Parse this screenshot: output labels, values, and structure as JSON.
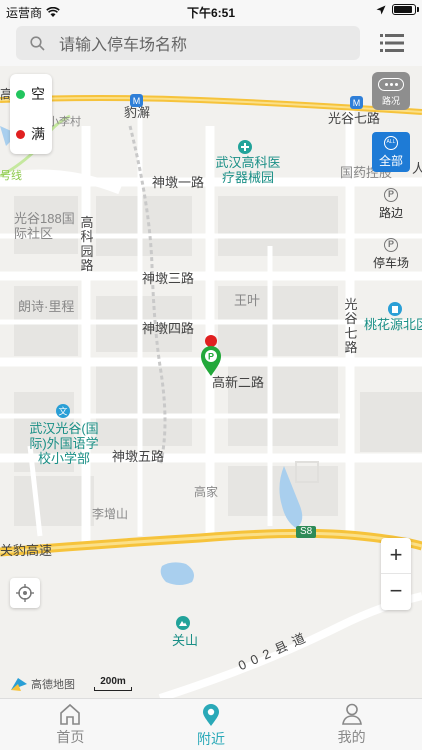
{
  "status_bar": {
    "carrier": "运营商",
    "time": "下午6:51",
    "battery_level": 0.9
  },
  "search": {
    "placeholder": "请输入停车场名称",
    "icon": "search-icon"
  },
  "header": {
    "menu_icon": "list-menu-icon"
  },
  "legend": {
    "empty_label": "空",
    "full_label": "满",
    "empty_color": "#22c55e",
    "full_color": "#e02020"
  },
  "map_controls": {
    "traffic_label": "路况",
    "all_label": "全部",
    "all_badge": "ALL",
    "roadside_label": "路边",
    "parking_lot_label": "停车场",
    "zoom_in": "+",
    "zoom_out": "−",
    "scale_label": "200m",
    "map_brand": "高德地图"
  },
  "map_labels": {
    "baojie": "豹澥",
    "guanggu7_top": "光谷七路",
    "gaoke_hospital": "武汉高科医疗器械园",
    "guoyao": "国药控股",
    "shendun1": "神墩一路",
    "guanggu188": "光谷188国际社区",
    "gaokeyuan": "高科园路",
    "shendun3": "神墩三路",
    "langshi": "朗诗·里程",
    "wangye": "王叶",
    "guanggu7_v": "光谷七路",
    "taohuayuan": "桃花源北区",
    "shendun4": "神墩四路",
    "gaoxin2": "高新二路",
    "school": "武汉光谷(国际)外国语学校小学部",
    "shendun5": "神墩五路",
    "gaojia": "高家",
    "lizengshan": "李增山",
    "expressway": "关豹高速",
    "s8": "S8",
    "guanshan": "关山",
    "county_road": "002县道",
    "xiaolicun": "小李村",
    "gao_edge": "高",
    "ren_edge": "人",
    "hao_edge": "号线"
  },
  "tabs": [
    {
      "label": "首页",
      "icon": "home-icon",
      "active": false
    },
    {
      "label": "附近",
      "icon": "location-pin-icon",
      "active": true
    },
    {
      "label": "我的",
      "icon": "user-icon",
      "active": false
    }
  ],
  "colors": {
    "accent": "#2aa9b8",
    "road_yellow": "#f6c33b",
    "all_blue": "#1e7bd6"
  }
}
